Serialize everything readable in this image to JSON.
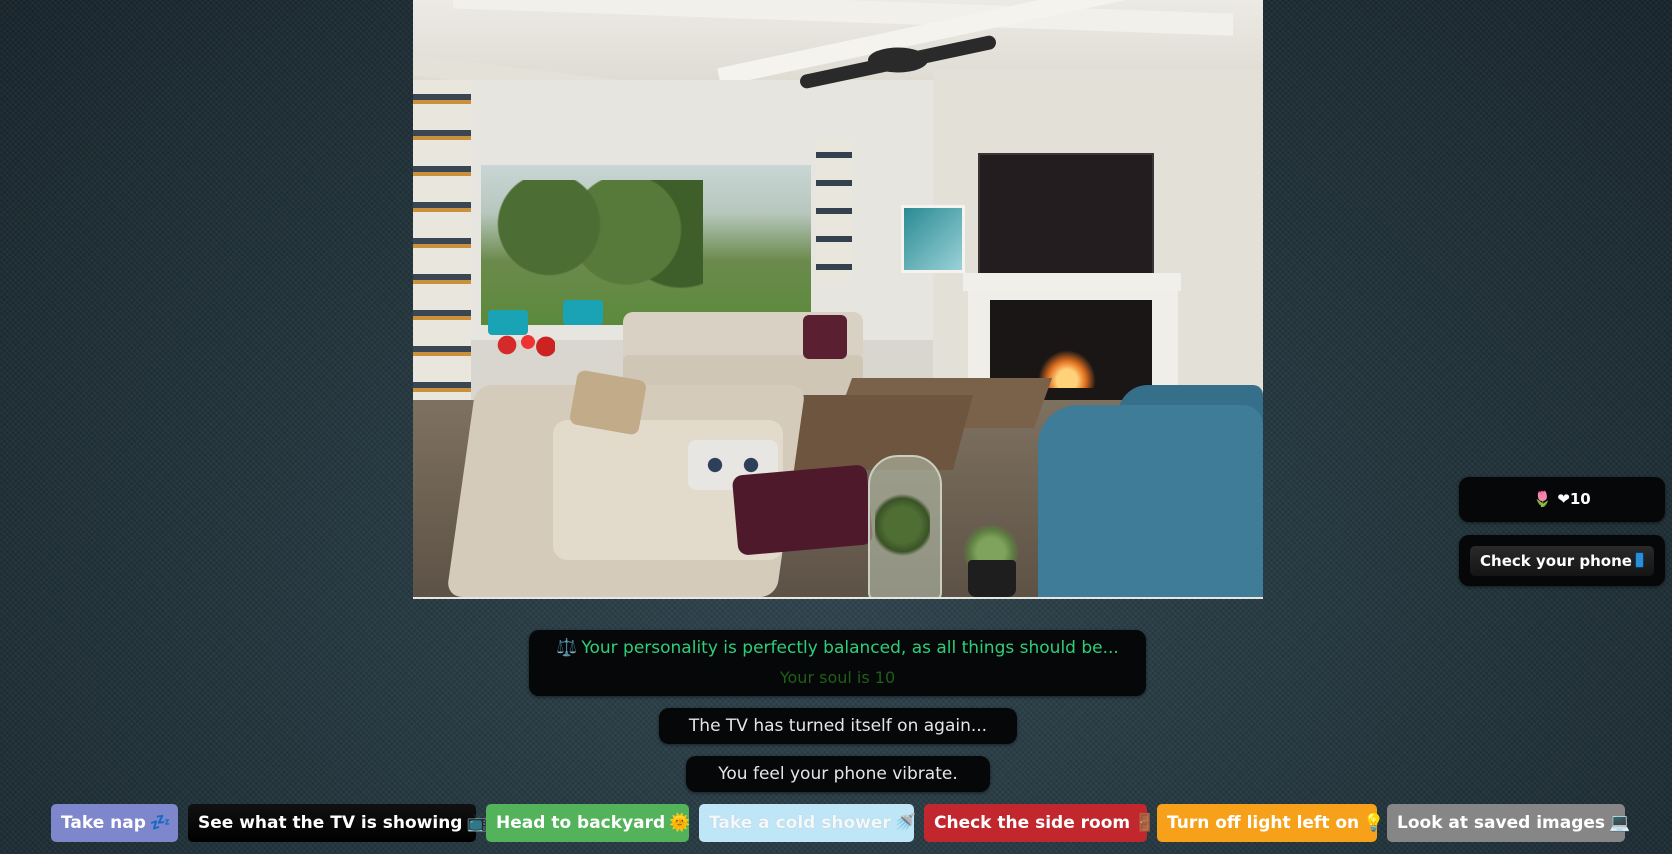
{
  "scene": {
    "description": "living room photo with ceiling fan, wall-mounted TV, fireplace, beige sectional sofa, blue armchairs, coffee tables and open doors to backyard"
  },
  "status": {
    "balance_icon": "balance-scale-icon",
    "balance_glyph": "⚖️",
    "balance_text": "Your personality is perfectly balanced, as all things should be...",
    "soul_text": "Your soul is 10",
    "balance_color": "#2ecf7a",
    "soul_color": "#1f5f16"
  },
  "messages": [
    "The TV has turned itself on again...",
    "You feel your phone vibrate."
  ],
  "side_panel": {
    "tulip_glyph": "🌷",
    "heart_glyph": "❤",
    "love_value": "10",
    "phone_button_label": "Check your phone"
  },
  "actions": [
    {
      "label": "Take nap",
      "icon": "💤",
      "color": "#7f87cc"
    },
    {
      "label": "See what the TV is showing",
      "icon": "📺",
      "color": "#000000"
    },
    {
      "label": "Head to backyard",
      "icon": "🌞",
      "color": "#52b35a"
    },
    {
      "label": "Take a cold shower",
      "icon": "🚿",
      "color": "#bfe6f7"
    },
    {
      "label": "Check the side room",
      "icon": "🚪",
      "color": "#c1272d"
    },
    {
      "label": "Turn off light left on",
      "icon": "💡",
      "color": "#f7a11b"
    },
    {
      "label": "Look at saved images",
      "icon": "💻",
      "color": "#868686"
    }
  ]
}
